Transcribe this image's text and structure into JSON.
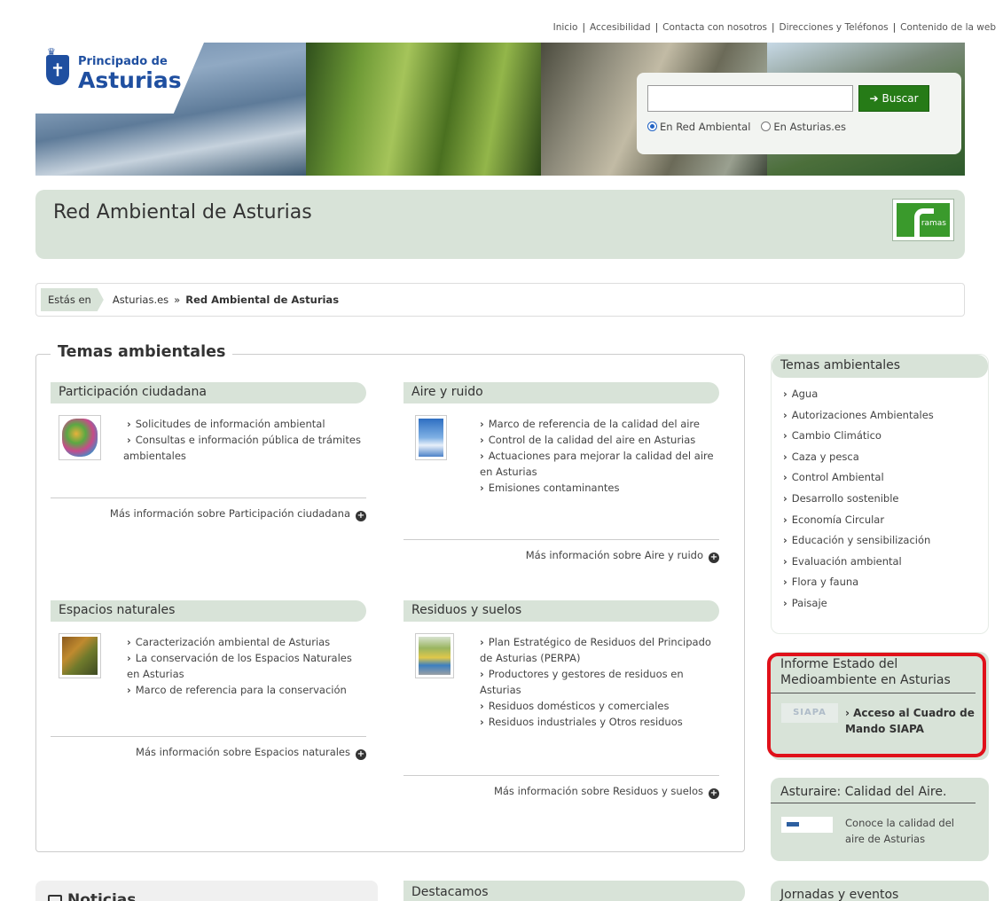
{
  "top_links": [
    "Inicio",
    "Accesibilidad",
    "Contacta con nosotros",
    "Direcciones y Teléfonos",
    "Contenido de la web"
  ],
  "logo": {
    "line1": "Principado de",
    "line2": "Asturias"
  },
  "search": {
    "value": "",
    "button_label": "Buscar",
    "radio1": "En Red Ambiental",
    "radio2": "En Asturias.es",
    "selected": "En Red Ambiental"
  },
  "page_title": "Red Ambiental de Asturias",
  "rama_logo_text": "ramas",
  "breadcrumb": {
    "label": "Estás en",
    "link": "Asturias.es",
    "sep": "»",
    "current": "Red Ambiental de Asturias"
  },
  "main": {
    "heading": "Temas ambientales",
    "topics": [
      {
        "title": "Participación ciudadana",
        "items": [
          "Solicitudes de información ambiental",
          "Consultas e información pública de trámites ambientales"
        ],
        "more": "Más información sobre Participación ciudadana"
      },
      {
        "title": "Aire y ruido",
        "items": [
          "Marco de referencia de la calidad del aire",
          "Control de la calidad del aire en Asturias",
          "Actuaciones para mejorar la calidad del aire en Asturias",
          "Emisiones contaminantes"
        ],
        "more": "Más información sobre Aire y ruido"
      },
      {
        "title": "Espacios naturales",
        "items": [
          "Caracterización ambiental de Asturias",
          "La conservación de los Espacios Naturales en Asturias",
          "Marco de referencia para la conservación"
        ],
        "more": "Más información sobre Espacios naturales"
      },
      {
        "title": "Residuos y suelos",
        "items": [
          "Plan Estratégico de Residuos del Principado de Asturias (PERPA)",
          "Productores y gestores de residuos en Asturias",
          "Residuos domésticos y comerciales",
          "Residuos industriales y Otros residuos"
        ],
        "more": "Más información sobre Residuos y suelos"
      }
    ]
  },
  "sidebar": {
    "themes_title": "Temas ambientales",
    "themes": [
      "Agua",
      "Autorizaciones Ambientales",
      "Cambio Climático",
      "Caza y pesca",
      "Control Ambiental",
      "Desarrollo sostenible",
      "Economía Circular",
      "Educación y sensibilización",
      "Evaluación ambiental",
      "Flora y fauna",
      "Paisaje"
    ],
    "informe_title": "Informe Estado del Medioambiente en Asturias",
    "siapa_logo": "SIAPA",
    "siapa_link": "Acceso al Cuadro de Mando SIAPA",
    "asturaire_title": "Asturaire: Calidad del Aire.",
    "asturaire_text": "Conoce la calidad del aire de Asturias",
    "jornadas_title": "Jornadas y eventos"
  },
  "noticias_title": "Noticias",
  "destacamos_title": "Destacamos",
  "colors": {
    "panel_green": "#d8e3d8",
    "button_green": "#267b17",
    "highlight_red": "#e0111a",
    "brand_blue": "#1f4fa0"
  }
}
